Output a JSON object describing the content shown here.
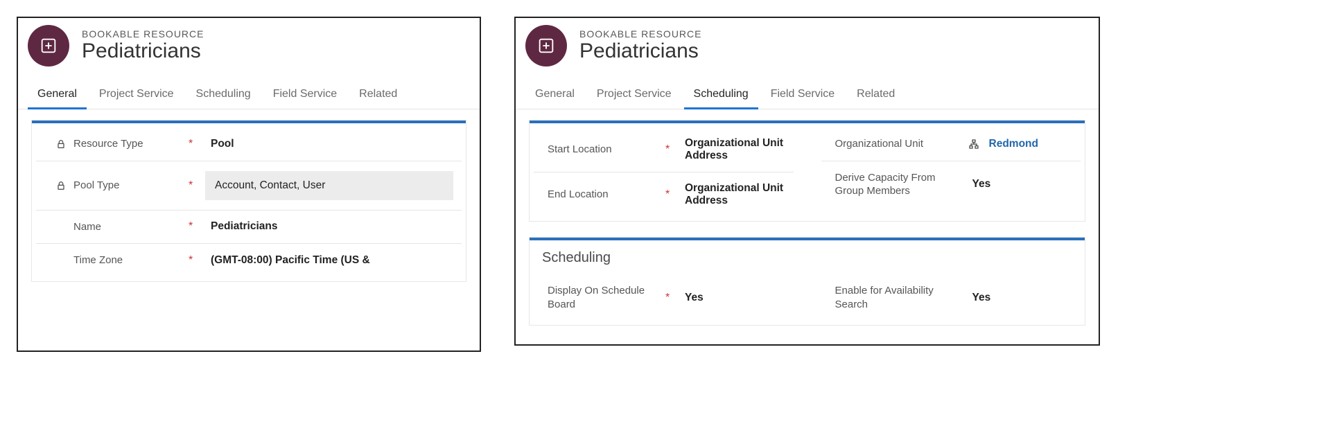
{
  "header_entity": "BOOKABLE RESOURCE",
  "header_title": "Pediatricians",
  "left": {
    "tabs": [
      "General",
      "Project Service",
      "Scheduling",
      "Field Service",
      "Related"
    ],
    "active_tab": "General",
    "fields": [
      {
        "label": "Resource Type",
        "locked": true,
        "required": true,
        "value": "Pool",
        "style": "bold"
      },
      {
        "label": "Pool Type",
        "locked": true,
        "required": true,
        "value": "Account, Contact, User",
        "style": "boxed"
      },
      {
        "label": "Name",
        "locked": false,
        "required": true,
        "value": "Pediatricians",
        "style": "bold"
      },
      {
        "label": "Time Zone",
        "locked": false,
        "required": true,
        "value": "(GMT-08:00) Pacific Time (US &",
        "style": "bold"
      }
    ]
  },
  "right": {
    "tabs": [
      "General",
      "Project Service",
      "Scheduling",
      "Field Service",
      "Related"
    ],
    "active_tab": "Scheduling",
    "section1": {
      "left": [
        {
          "label": "Start Location",
          "required": true,
          "value": "Organizational Unit Address",
          "style": "bold"
        },
        {
          "label": "End Location",
          "required": true,
          "value": "Organizational Unit Address",
          "style": "bold"
        }
      ],
      "right": [
        {
          "label": "Organizational Unit",
          "required": false,
          "value": "Redmond",
          "style": "lookup"
        },
        {
          "label": "Derive Capacity From Group Members",
          "required": false,
          "value": "Yes",
          "style": "bold"
        }
      ]
    },
    "section2": {
      "title": "Scheduling",
      "left": [
        {
          "label": "Display On Schedule Board",
          "required": true,
          "value": "Yes",
          "style": "bold"
        }
      ],
      "right": [
        {
          "label": "Enable for Availability Search",
          "required": false,
          "value": "Yes",
          "style": "bold"
        }
      ]
    }
  }
}
